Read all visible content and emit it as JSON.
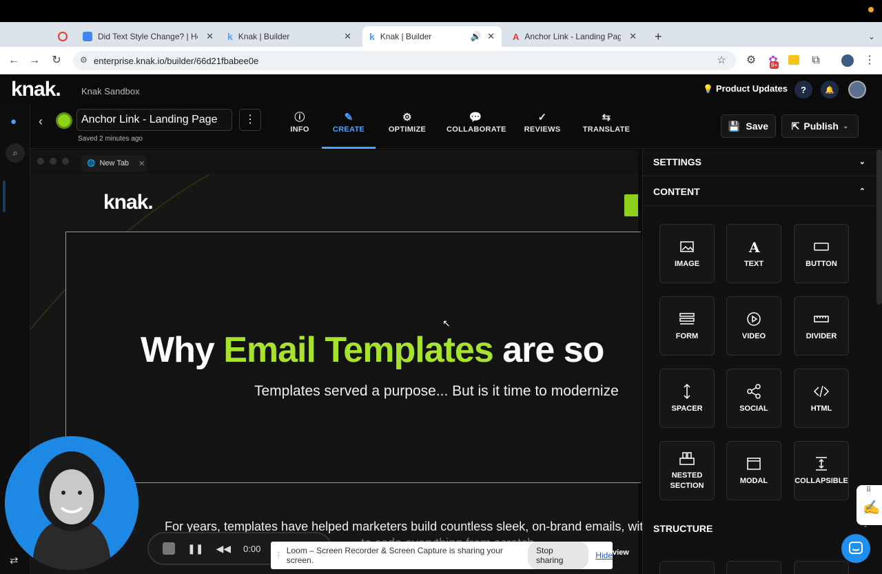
{
  "browser": {
    "tabs": [
      {
        "label": "",
        "favicon_color": "#e53935"
      },
      {
        "label": "Did Text Style Change? | Help",
        "favicon_color": "#4285f4"
      },
      {
        "label": "Knak | Builder",
        "favicon_color": "#4aa3ff"
      },
      {
        "label": "Knak | Builder",
        "favicon_color": "#4aa3ff"
      },
      {
        "label": "Anchor Link - Landing Page -",
        "favicon_color": "#e53935"
      }
    ],
    "url": "enterprise.knak.io/builder/66d21fbabee0e",
    "ext_badge": "9+"
  },
  "app": {
    "logo": "knak.",
    "workspace": "Knak Sandbox",
    "product_updates": "Product Updates",
    "help": "?"
  },
  "editor": {
    "page_name": "Anchor Link - Landing Page",
    "saved_status": "Saved 2 minutes ago",
    "nav": [
      {
        "label": "INFO",
        "icon": "info-icon"
      },
      {
        "label": "CREATE",
        "icon": "edit-icon"
      },
      {
        "label": "OPTIMIZE",
        "icon": "gear-icon"
      },
      {
        "label": "COLLABORATE",
        "icon": "chat-icon"
      },
      {
        "label": "REVIEWS",
        "icon": "check-circle-icon"
      },
      {
        "label": "TRANSLATE",
        "icon": "translate-icon"
      }
    ],
    "save_label": "Save",
    "publish_label": "Publish",
    "accent_color": "#4aa3ff"
  },
  "canvas": {
    "inner_tab": "New Tab",
    "page_logo": "knak.",
    "headline_pre": "Why ",
    "headline_green": "Email Templates",
    "headline_post": " are so",
    "subhead": "Templates served a purpose... But is it time to modernize",
    "body": "For years, templates have helped marketers build countless sleek, on-brand emails, wit",
    "body2": "to code everything from scratch.",
    "green_color": "#a6e22e"
  },
  "panel": {
    "settings": "SETTINGS",
    "content": "CONTENT",
    "structure": "STRUCTURE",
    "blocks": [
      {
        "label": "IMAGE",
        "icon": "image-icon"
      },
      {
        "label": "TEXT",
        "icon": "text-icon"
      },
      {
        "label": "BUTTON",
        "icon": "button-icon"
      },
      {
        "label": "FORM",
        "icon": "form-icon"
      },
      {
        "label": "VIDEO",
        "icon": "video-icon"
      },
      {
        "label": "DIVIDER",
        "icon": "divider-icon"
      },
      {
        "label": "SPACER",
        "icon": "spacer-icon"
      },
      {
        "label": "SOCIAL",
        "icon": "social-icon"
      },
      {
        "label": "HTML",
        "icon": "code-icon"
      },
      {
        "label": "NESTED SECTION",
        "icon": "nested-icon"
      },
      {
        "label": "MODAL",
        "icon": "modal-icon"
      },
      {
        "label": "COLLAPSIBLE",
        "icon": "collapse-icon"
      }
    ]
  },
  "loom": {
    "time": "0:00",
    "share_message": "Loom – Screen Recorder & Screen Capture is sharing your screen.",
    "stop_sharing": "Stop sharing",
    "hide": "Hide",
    "view": "view"
  }
}
